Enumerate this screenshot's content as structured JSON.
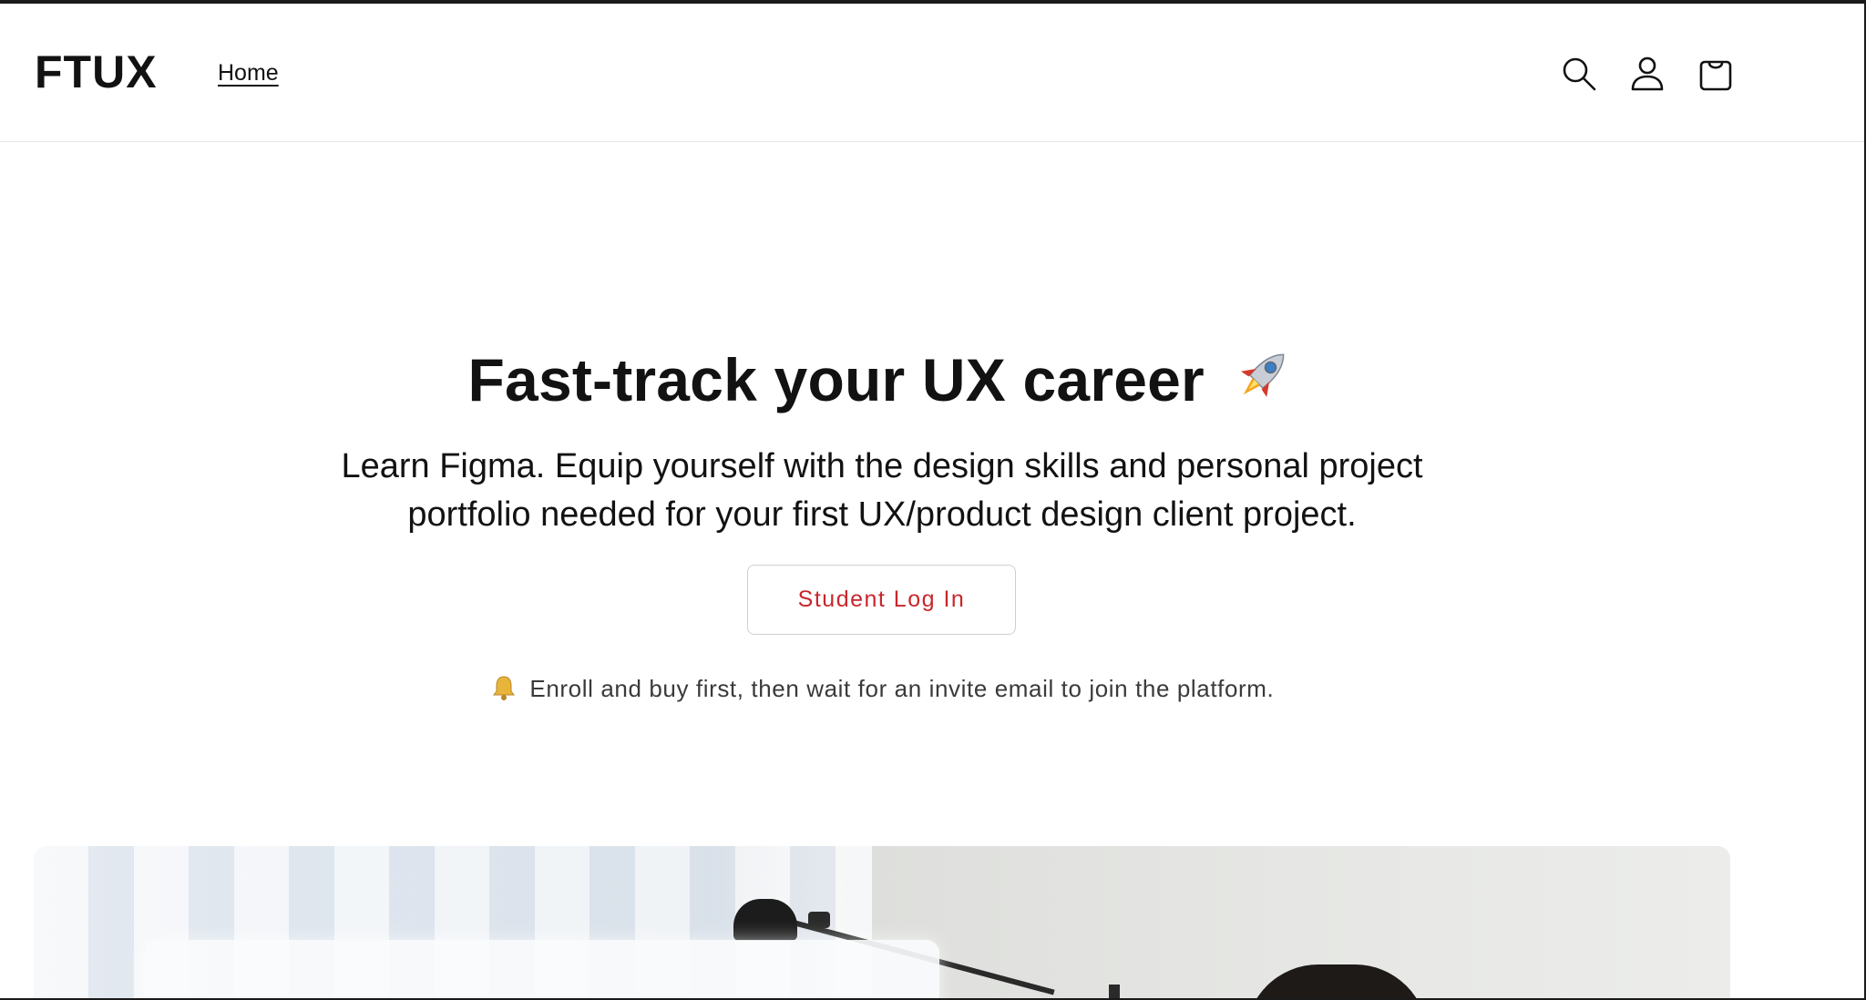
{
  "header": {
    "logo": "FTUX",
    "nav": [
      {
        "label": "Home"
      }
    ],
    "icons": [
      "search-icon",
      "account-icon",
      "cart-icon"
    ]
  },
  "hero": {
    "title": "Fast-track your UX career",
    "title_emoji": "rocket-emoji",
    "subtitle": "Learn Figma. Equip yourself with the design skills and personal project portfolio needed for your first UX/product design client project.",
    "button_label": "Student Log In",
    "note": "Enroll and buy first, then wait for an invite email to join the platform.",
    "note_emoji": "bell-emoji"
  },
  "colors": {
    "accent": "#c8262b",
    "text": "#121212",
    "border": "#cfcfcf"
  }
}
